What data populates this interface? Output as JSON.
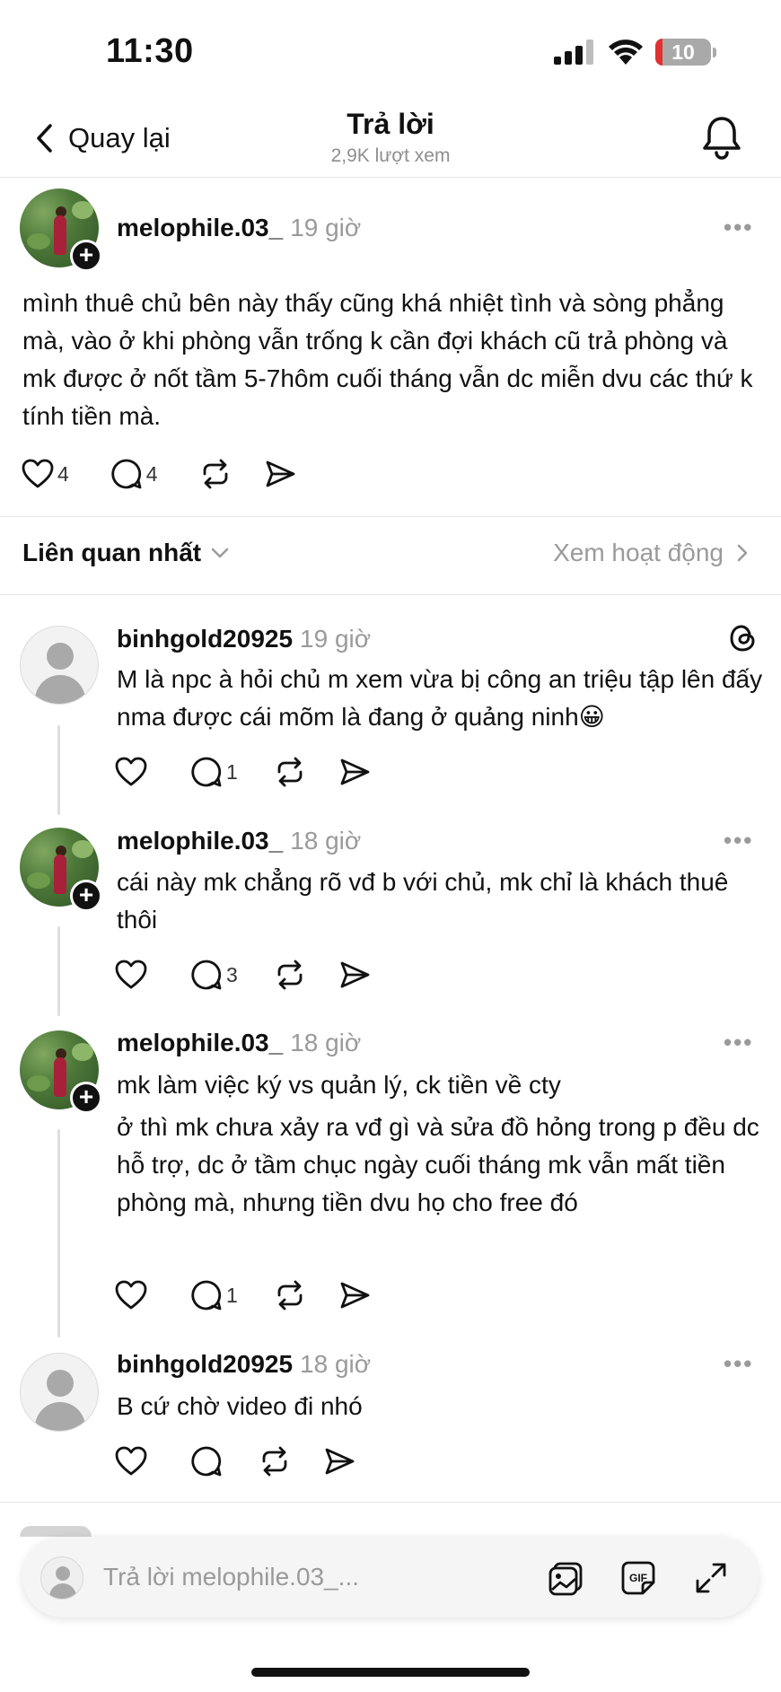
{
  "status_bar": {
    "time": "11:30",
    "battery": "10"
  },
  "nav": {
    "back_label": "Quay lại",
    "title": "Trả lời",
    "views": "2,9K lượt xem"
  },
  "post": {
    "username": "melophile.03_",
    "time": "19 giờ",
    "text": "mình thuê chủ bên này thấy cũng khá nhiệt tình và sòng phẳng mà, vào ở khi phòng vẫn trống k cần đợi khách cũ trả phòng và mk được ở nốt tầm 5-7hôm cuối tháng vẫn dc miễn dvu các thứ k tính tiền mà.",
    "likes": "4",
    "comments": "4"
  },
  "sort": {
    "label": "Liên quan nhất",
    "activity_label": "Xem hoạt động"
  },
  "replies": [
    {
      "username": "binhgold20925",
      "time": "19 giờ",
      "text": "M là npc à hỏi chủ m xem vừa bị công an triệu tập lên đấy nma được cái mõm là đang ở quảng ninh😀",
      "comments": "1"
    },
    {
      "username": "melophile.03_",
      "time": "18 giờ",
      "text": "cái này mk chẳng rõ vđ b với chủ, mk chỉ là khách thuê thôi",
      "comments": "3"
    },
    {
      "username": "melophile.03_",
      "time": "18 giờ",
      "text_line1": "mk làm việc ký vs quản lý, ck tiền về cty",
      "text_line2": "ở thì mk chưa xảy ra vđ gì và sửa đồ hỏng trong p đều dc hỗ trợ, dc ở tầm chục ngày cuối tháng mk vẫn mất tiền phòng mà, nhưng tiền dvu họ cho free đó",
      "comments": "1"
    },
    {
      "username": "binhgold20925",
      "time": "18 giờ",
      "text": "B cứ chờ video đi nhó",
      "comments": ""
    }
  ],
  "reply_bar": {
    "placeholder": "Trả lời melophile.03_..."
  },
  "icons": [
    "signal-icon",
    "wifi-icon",
    "battery-icon",
    "chevron-left-icon",
    "bell-icon",
    "heart-icon",
    "comment-icon",
    "repost-icon",
    "share-icon",
    "more-icon",
    "threads-icon",
    "chevron-down-icon",
    "chevron-right-icon",
    "image-icon",
    "gif-icon",
    "expand-icon"
  ]
}
